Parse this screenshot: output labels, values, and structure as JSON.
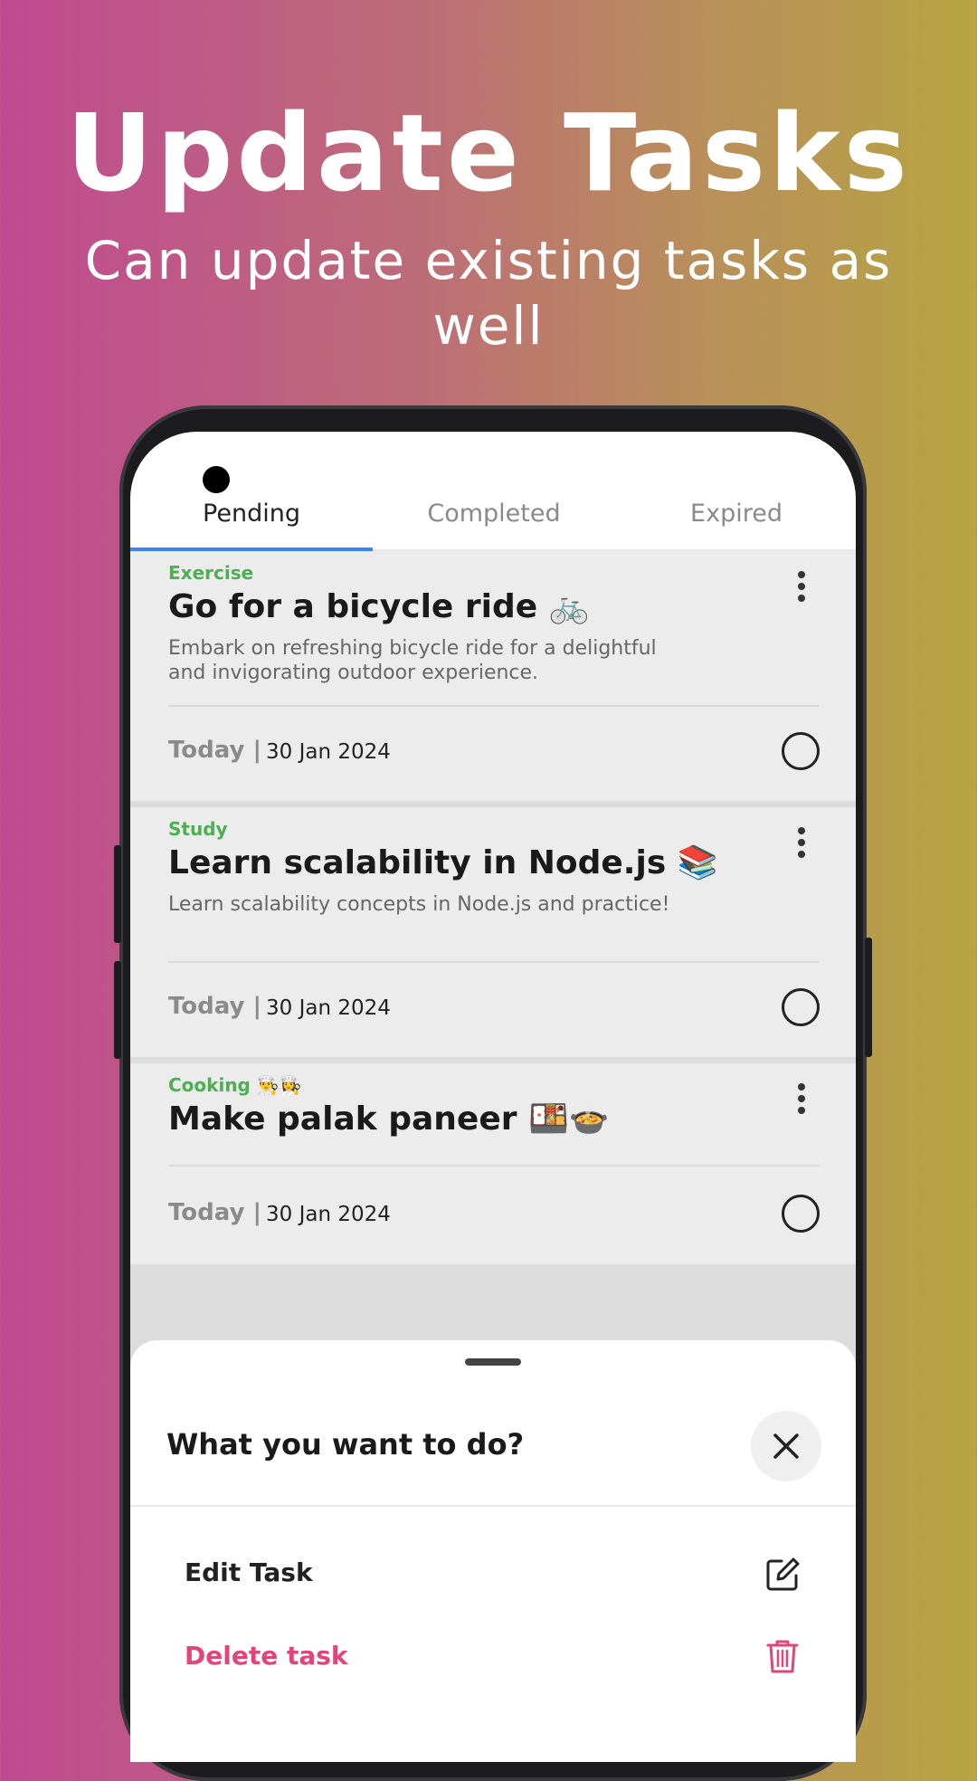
{
  "hero": {
    "title": "Update Tasks",
    "subtitle": "Can update existing tasks as well"
  },
  "tabs": [
    {
      "label": "Pending",
      "active": true
    },
    {
      "label": "Completed",
      "active": false
    },
    {
      "label": "Expired",
      "active": false
    }
  ],
  "tasks": [
    {
      "category": "Exercise",
      "title": "Go for a bicycle ride 🚲",
      "description": "Embark on refreshing bicycle ride for a delightful and invigorating outdoor experience.",
      "day": "Today |",
      "date": "30 Jan 2024"
    },
    {
      "category": "Study",
      "title": "Learn scalability in Node.js 📚",
      "description": "Learn scalability concepts in Node.js and practice!",
      "day": "Today |",
      "date": "30 Jan 2024"
    },
    {
      "category": "Cooking 👨‍🍳👩‍🍳",
      "title": "Make palak paneer 🍱🍲",
      "description": "",
      "day": "Today |",
      "date": "30 Jan 2024"
    }
  ],
  "sheet": {
    "title": "What you want to do?",
    "edit_label": "Edit Task",
    "delete_label": "Delete task"
  },
  "colors": {
    "category": "#4caf50",
    "tab_indicator": "#3b82f6",
    "delete": "#e0457b"
  },
  "icons": {
    "close": "close-icon",
    "edit": "edit-icon",
    "delete": "trash-icon",
    "menu": "more-vertical-icon",
    "complete": "circle-icon"
  }
}
